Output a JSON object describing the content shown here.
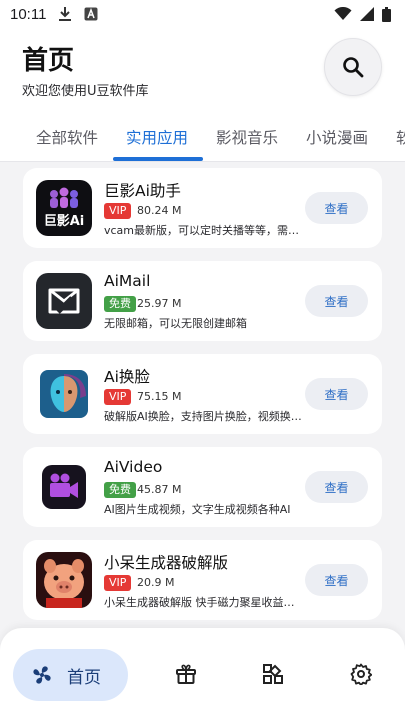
{
  "status_bar": {
    "time": "10:11",
    "icons": [
      "download-icon",
      "a-box-icon",
      "wifi-icon",
      "signal-icon",
      "battery-icon"
    ]
  },
  "header": {
    "title": "首页",
    "subtitle": "欢迎您使用U豆软件库",
    "search_icon": "search-icon"
  },
  "tabs": [
    {
      "label": "全部软件",
      "active": false
    },
    {
      "label": "实用应用",
      "active": true
    },
    {
      "label": "影视音乐",
      "active": false
    },
    {
      "label": "小说漫画",
      "active": false
    },
    {
      "label": "软",
      "active": false
    }
  ],
  "accent_color": "#1e6fd6",
  "apps": [
    {
      "name": "巨影Ai助手",
      "badge": "VIP",
      "size": "80.24 M",
      "desc": "vcam最新版，可以定时关播等等，需要定制联系我",
      "button": "查看",
      "icon": "juying-ai-app-icon"
    },
    {
      "name": "AiMail",
      "badge": "免费",
      "size": "25.97 M",
      "desc": "无限邮箱，可以无限创建邮箱",
      "button": "查看",
      "icon": "aimail-app-icon"
    },
    {
      "name": "Ai换脸",
      "badge": "VIP",
      "size": "75.15 M",
      "desc": "破解版AI换脸，支持图片换脸，视频换脸等功能",
      "button": "查看",
      "icon": "ai-faceswap-app-icon"
    },
    {
      "name": "AiVideo",
      "badge": "免费",
      "size": "45.87 M",
      "desc": "AI图片生成视频，文字生成视频各种AI",
      "button": "查看",
      "icon": "aivideo-app-icon"
    },
    {
      "name": "小呆生成器破解版",
      "badge": "VIP",
      "size": "20.9 M",
      "desc": "小呆生成器破解版 快手磁力聚星收益生成器",
      "button": "查看",
      "icon": "xiaodai-app-icon"
    }
  ],
  "bottom_nav": {
    "home_label": "首页",
    "items": [
      "home-icon",
      "gift-box-icon",
      "apps-grid-icon",
      "settings-icon"
    ]
  }
}
